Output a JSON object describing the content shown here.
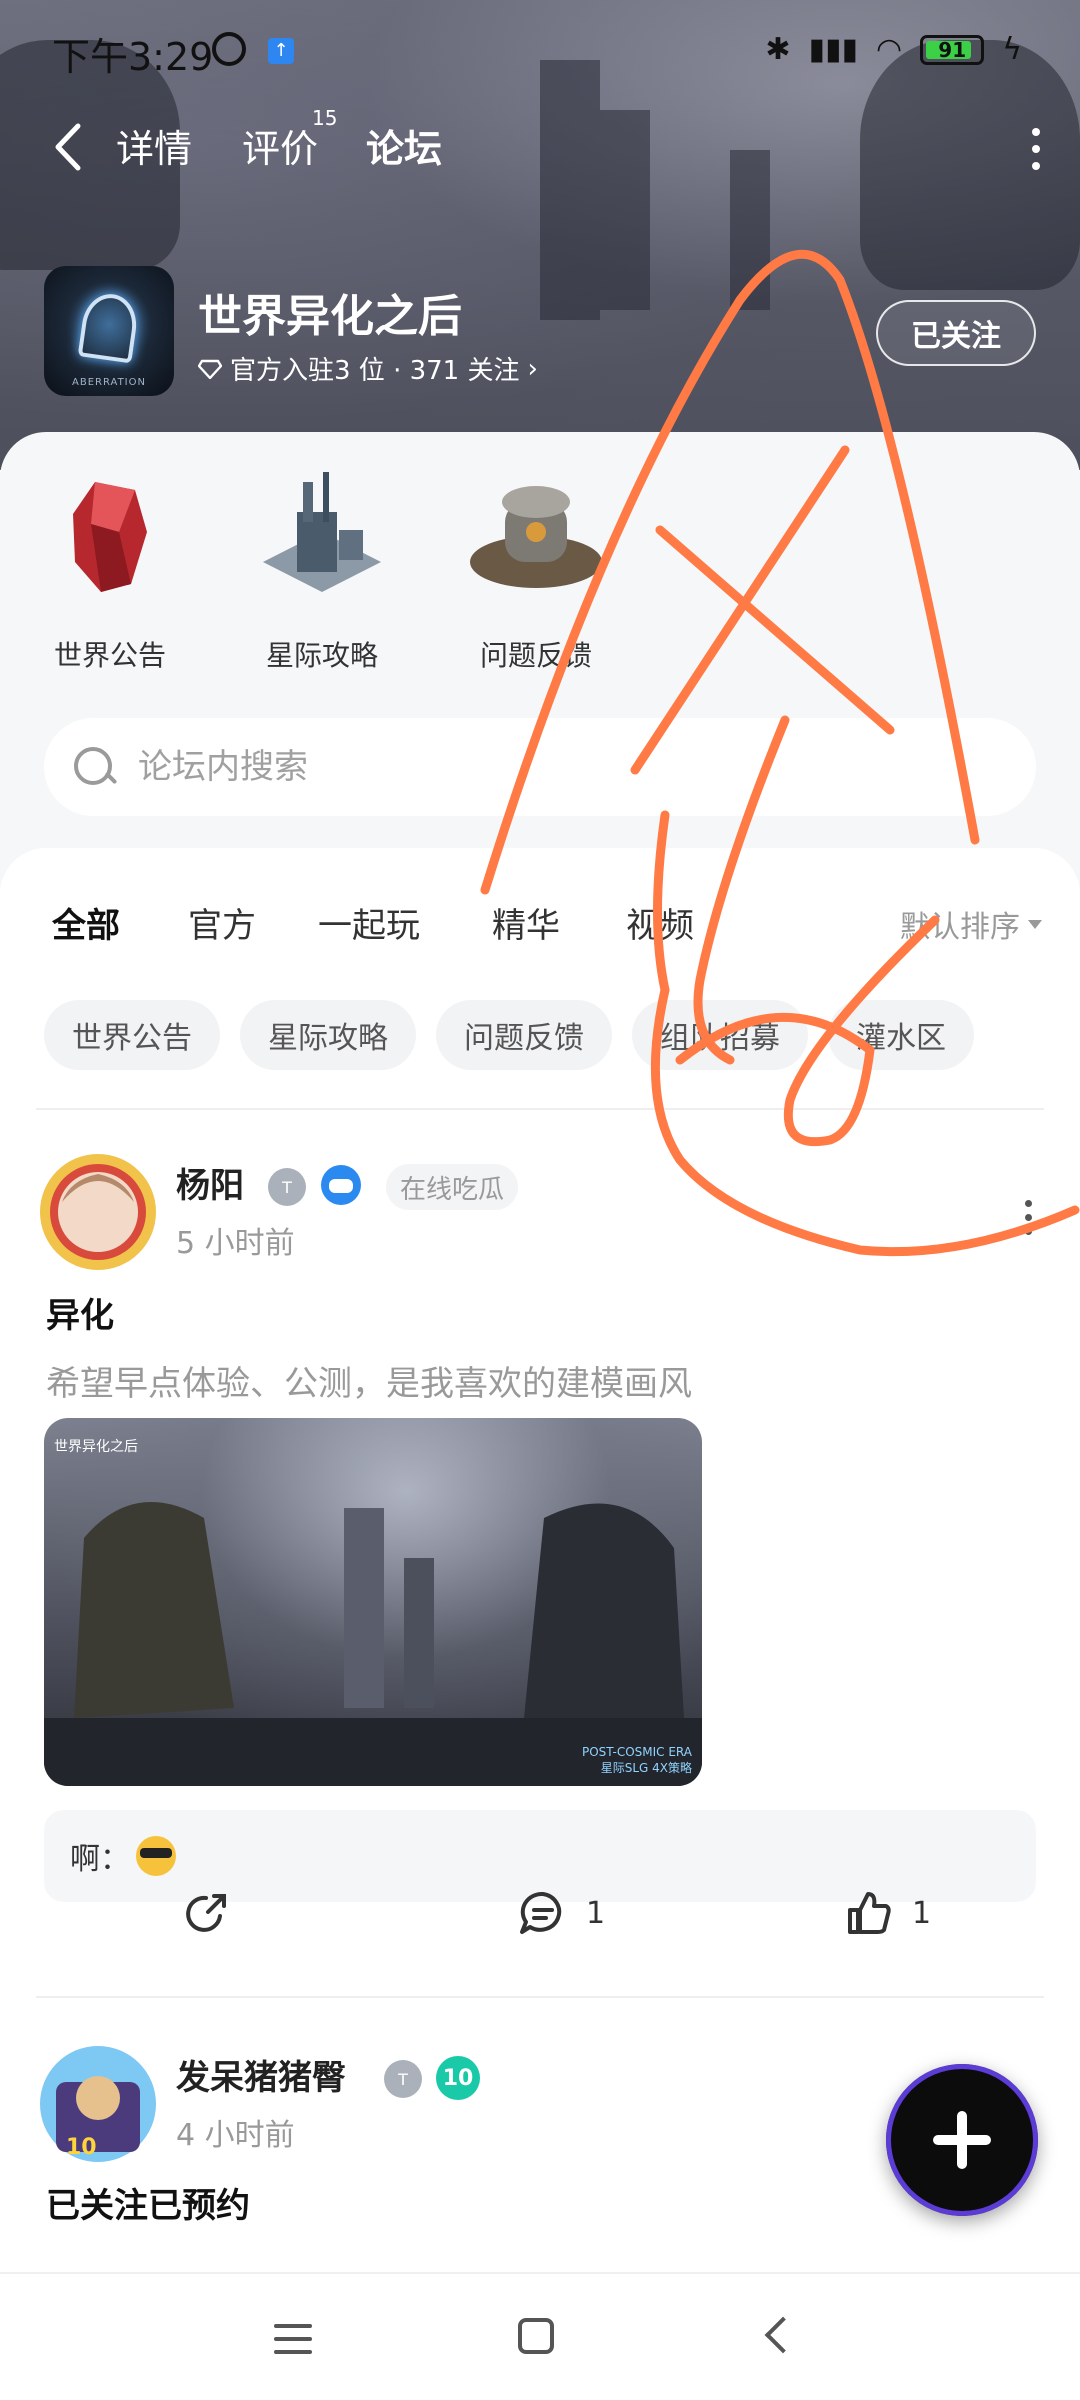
{
  "status_bar": {
    "time": "下午3:29",
    "battery": "91",
    "icons": [
      "alarm-icon",
      "upload-icon",
      "bluetooth-icon",
      "signal-icon",
      "wifi-icon",
      "battery-icon",
      "charging-icon"
    ]
  },
  "nav": {
    "tabs": [
      {
        "label": "详情"
      },
      {
        "label": "评价",
        "badge": "15"
      },
      {
        "label": "论坛",
        "active": true
      }
    ]
  },
  "game": {
    "title": "世界异化之后",
    "meta_prefix": "官方入驻3 位 · 371 关注",
    "follow_label": "已关注",
    "logo_caption": "ABERRATION"
  },
  "categories": [
    {
      "label": "世界公告"
    },
    {
      "label": "星际攻略"
    },
    {
      "label": "问题反馈"
    }
  ],
  "search": {
    "placeholder": "论坛内搜索"
  },
  "filter_tabs": [
    {
      "label": "全部",
      "active": true
    },
    {
      "label": "官方"
    },
    {
      "label": "一起玩"
    },
    {
      "label": "精华"
    },
    {
      "label": "视频"
    }
  ],
  "sort": {
    "label": "默认排序"
  },
  "chips": [
    "世界公告",
    "星际攻略",
    "问题反馈",
    "组队招募",
    "灌水区"
  ],
  "posts": [
    {
      "user": "杨阳",
      "tag": "在线吃瓜",
      "time": "5 小时前",
      "title": "异化",
      "body": "希望早点体验、公测，是我喜欢的建模画风",
      "image_caption": "世界异化之后",
      "image_footer_1": "POST-COSMIC ERA",
      "image_footer_2": "星际SLG 4X策略",
      "comment_prefix": "啊：",
      "comments": "1",
      "likes": "1"
    },
    {
      "user": "发呆猪猪臀",
      "time": "4 小时前",
      "title": "已关注已预约",
      "level_badge": "10"
    }
  ],
  "colors": {
    "accent": "#14c6a0",
    "scribble": "#ff7a45"
  }
}
